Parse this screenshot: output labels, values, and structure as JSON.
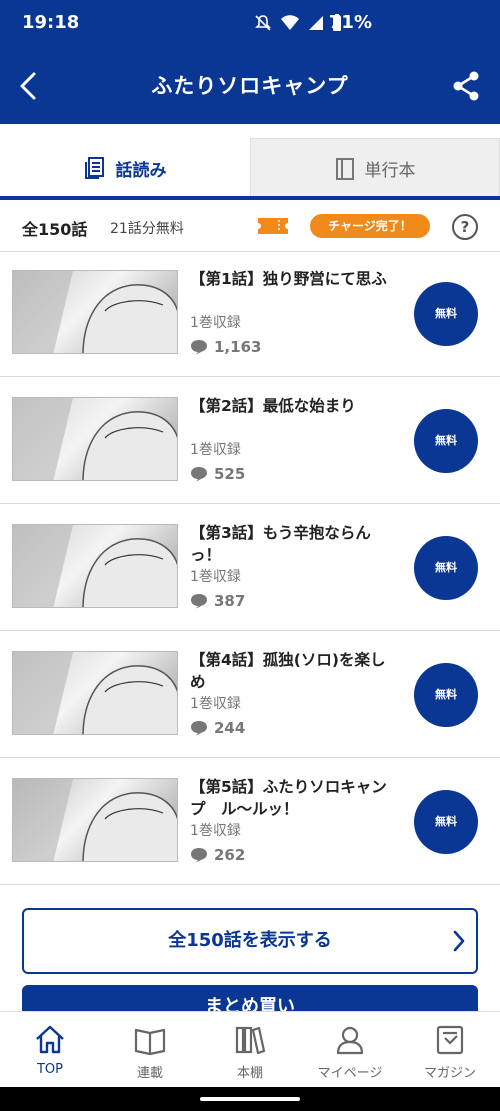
{
  "status_bar": {
    "time": "19:18",
    "battery": "71%"
  },
  "header": {
    "title": "ふたりソロキャンプ"
  },
  "tabs": [
    {
      "label": "話読み",
      "active": true
    },
    {
      "label": "単行本",
      "active": false
    }
  ],
  "info": {
    "total": "全150話",
    "free": "21話分無料",
    "charge_badge": "チャージ完了！",
    "help": "?"
  },
  "episodes": [
    {
      "title": "【第1話】独り野営にて思ふ",
      "volume": "1巻収録",
      "comments": "1,163",
      "button": "無料"
    },
    {
      "title": "【第2話】最低な始まり",
      "volume": "1巻収録",
      "comments": "525",
      "button": "無料"
    },
    {
      "title": "【第3話】もう辛抱ならんっ！",
      "volume": "1巻収録",
      "comments": "387",
      "button": "無料"
    },
    {
      "title": "【第4話】孤独(ソロ)を楽しめ",
      "volume": "1巻収録",
      "comments": "244",
      "button": "無料"
    },
    {
      "title": "【第5話】ふたりソロキャンプ　ル〜ルッ！",
      "volume": "1巻収録",
      "comments": "262",
      "button": "無料"
    }
  ],
  "show_all_label": "全150話を表示する",
  "bulk_buy_label": "まとめ買い",
  "bottom_nav": [
    {
      "label": "TOP",
      "icon": "home-icon",
      "active": true
    },
    {
      "label": "連載",
      "icon": "book-open-icon",
      "active": false
    },
    {
      "label": "本棚",
      "icon": "bookshelf-icon",
      "active": false
    },
    {
      "label": "マイページ",
      "icon": "person-icon",
      "active": false
    },
    {
      "label": "マガジン",
      "icon": "magazine-icon",
      "active": false
    }
  ],
  "colors": {
    "brand": "#0a3694",
    "accent": "#f08a1a"
  }
}
